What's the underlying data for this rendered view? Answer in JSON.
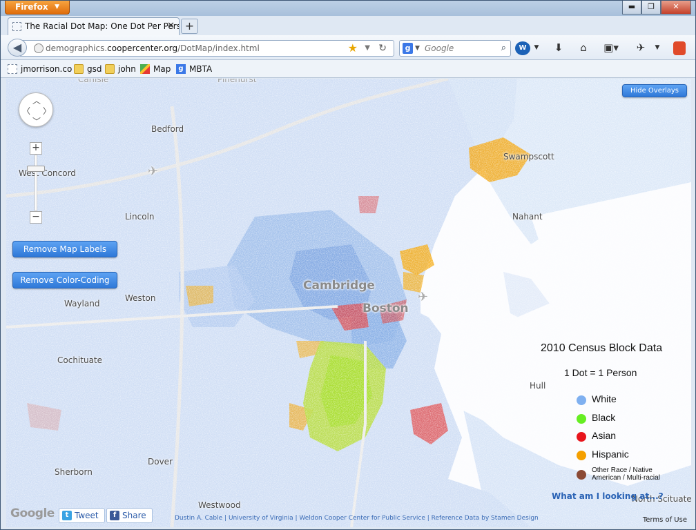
{
  "browser": {
    "app_button": "Firefox",
    "tab_title": "The Racial Dot Map: One Dot Per Person...",
    "url_prefix": "demographics.",
    "url_host": "coopercenter.org",
    "url_path": "/DotMap/index.html",
    "search_placeholder": "Google",
    "bookmarks": [
      "jmorrison.co",
      "gsd",
      "john",
      "Map",
      "MBTA"
    ]
  },
  "map": {
    "labels": {
      "bedford": "Bedford",
      "west_concord": "West Concord",
      "lincoln": "Lincoln",
      "wayland": "Wayland",
      "weston": "Weston",
      "cochituate": "Cochituate",
      "dover": "Dover",
      "sherborn": "Sherborn",
      "westwood": "Westwood",
      "cambridge": "Cambridge",
      "boston": "Boston",
      "swampscott": "Swampscott",
      "nahant": "Nahant",
      "hull": "Hull",
      "north_scituate": "North Scituate",
      "carlisle": "Carlisle",
      "pinehurst": "Pinehurst"
    },
    "buttons": {
      "remove_labels": "Remove Map Labels",
      "remove_color": "Remove Color-Coding",
      "hide_overlays": "Hide Overlays"
    },
    "legend": {
      "title": "2010 Census Block Data",
      "subtitle": "1 Dot = 1 Person",
      "items": [
        {
          "label": "White",
          "color": "#7fb0f0"
        },
        {
          "label": "Black",
          "color": "#66ee22"
        },
        {
          "label": "Asian",
          "color": "#e8151c"
        },
        {
          "label": "Hispanic",
          "color": "#f5a000"
        },
        {
          "label": "Other Race / Native American / Multi-racial",
          "color": "#8b4a35"
        }
      ]
    },
    "what_link": "What am I looking at...?",
    "tweet": "Tweet",
    "share": "Share",
    "credits": "Dustin A. Cable | University of Virginia | Weldon Cooper Center for Public Service | Reference Data by Stamen Design",
    "terms": "Terms of Use",
    "google": "Google"
  }
}
